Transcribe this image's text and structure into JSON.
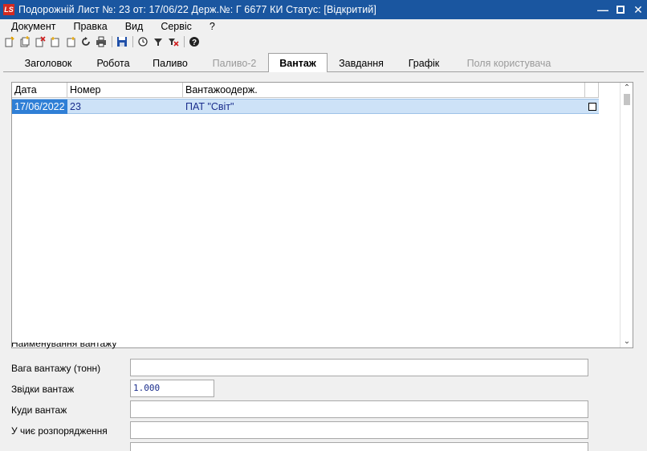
{
  "window": {
    "logo_text": "LS",
    "title": "Подорожній Лист №: 23   от: 17/06/22   Держ.№: Г 6677 КИ   Статус: [Відкритий]"
  },
  "menu": [
    "Документ",
    "Правка",
    "Вид",
    "Сервіс",
    "?"
  ],
  "toolbar_icons": [
    "new-icon",
    "new-copy-icon",
    "delete-icon",
    "add-icon",
    "add-alt-icon",
    "refresh-icon",
    "print-icon",
    "save-icon",
    "history-icon",
    "filter-icon",
    "clear-filter-icon",
    "help-icon"
  ],
  "tabs": [
    {
      "label": "Заголовок",
      "state": "normal"
    },
    {
      "label": "Робота",
      "state": "normal"
    },
    {
      "label": "Паливо",
      "state": "normal"
    },
    {
      "label": "Паливо-2",
      "state": "disabled"
    },
    {
      "label": "Вантаж",
      "state": "active"
    },
    {
      "label": "Завдання",
      "state": "normal"
    },
    {
      "label": "Графік",
      "state": "normal"
    },
    {
      "label": "Поля користувача",
      "state": "disabled"
    }
  ],
  "grid": {
    "columns": [
      "Дата",
      "Номер",
      "Вантажоодерж."
    ],
    "rows": [
      {
        "date": "17/06/2022",
        "number": "23",
        "recipient": "ПАТ \"Світ\"",
        "checked": false
      }
    ]
  },
  "form": {
    "clipped_label": "Найменування вантажу",
    "fields": [
      {
        "label": "Вага вантажу (тонн)",
        "value": ""
      },
      {
        "label": "Звідки вантаж",
        "value": "1.000"
      },
      {
        "label": "Куди вантаж",
        "value": ""
      },
      {
        "label": "У чиє розпорядження",
        "value": ""
      }
    ]
  }
}
